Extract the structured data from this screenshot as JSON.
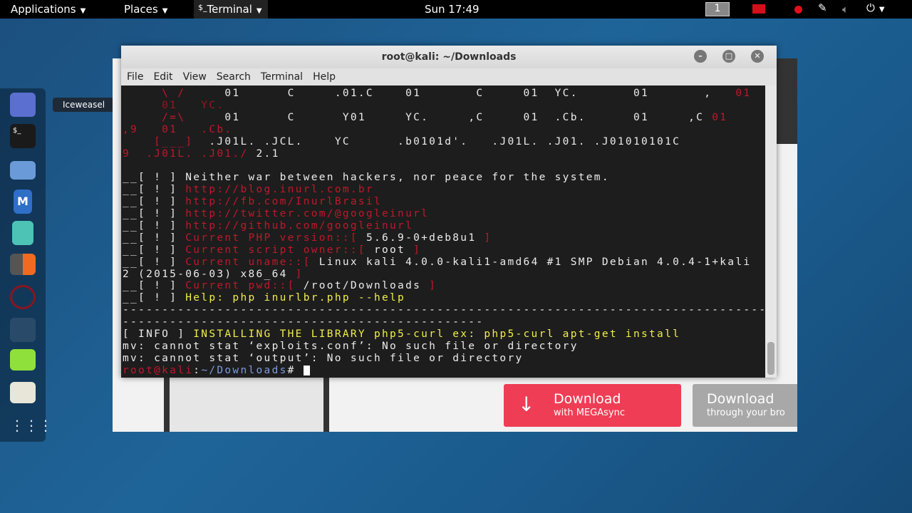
{
  "topbar": {
    "applications": "Applications",
    "places": "Places",
    "terminal_icon": "$_",
    "terminal": "Terminal",
    "clock": "Sun 17:49",
    "workspace": "1"
  },
  "dock": {
    "tooltip": "Iceweasel",
    "items": [
      "iceweasel",
      "terminal",
      "files",
      "metasploit",
      "armitage",
      "burpsuite",
      "faraday",
      "cherrytree",
      "leafpad",
      "settings",
      "show-apps"
    ]
  },
  "browser": {
    "download1_title": "Download",
    "download1_sub": "with MEGAsync",
    "download2_title": "Download",
    "download2_sub": "through your bro"
  },
  "window": {
    "title": "root@kali: ~/Downloads",
    "menu": [
      "File",
      "Edit",
      "View",
      "Search",
      "Terminal",
      "Help"
    ]
  },
  "terminal": {
    "lines": [
      [
        [
          "r",
          "     \\ /"
        ],
        [
          "w",
          "     01      C     .01.C    01       C     01  YC.       01       ,   "
        ],
        [
          "r",
          "01"
        ]
      ],
      [
        [
          "d",
          "     01   YC."
        ]
      ],
      [
        [
          "r",
          "     /=\\"
        ],
        [
          "w",
          "     01      C      Y01     YC.     ,C     01  .Cb.      01     ,C "
        ],
        [
          "r",
          "01"
        ]
      ],
      [
        [
          "r",
          ",9   01   .Cb."
        ]
      ],
      [
        [
          "r",
          "    [___]"
        ],
        [
          "w",
          "  .J01L. .JCL.    YC      .b0101d'.   .J01L. .J01. .J01010101C"
        ]
      ],
      [
        [
          "r",
          "9  .J01L. .J01./"
        ],
        [
          "w",
          " 2.1"
        ]
      ],
      [
        [
          "w",
          ""
        ]
      ],
      [
        [
          "w",
          "__[ ! ] Neither war between hackers, nor peace for the system."
        ]
      ],
      [
        [
          "w",
          "__[ ! ] "
        ],
        [
          "r",
          "http://blog.inurl.com.br"
        ]
      ],
      [
        [
          "w",
          "__[ ! ] "
        ],
        [
          "r",
          "http://fb.com/InurlBrasil"
        ]
      ],
      [
        [
          "w",
          "__[ ! ] "
        ],
        [
          "r",
          "http://twitter.com/@googleinurl"
        ]
      ],
      [
        [
          "w",
          "__[ ! ] "
        ],
        [
          "r",
          "http://github.com/googleinurl"
        ]
      ],
      [
        [
          "w",
          "__[ ! ] "
        ],
        [
          "r",
          "Current PHP version::[ "
        ],
        [
          "w",
          "5.6.9-0+deb8u1"
        ],
        [
          "r",
          " ]"
        ]
      ],
      [
        [
          "w",
          "__[ ! ] "
        ],
        [
          "r",
          "Current script owner::[ "
        ],
        [
          "w",
          "root"
        ],
        [
          "r",
          " ]"
        ]
      ],
      [
        [
          "w",
          "__[ ! ] "
        ],
        [
          "r",
          "Current uname::[ "
        ],
        [
          "w",
          "Linux kali 4.0.0-kali1-amd64 #1 SMP Debian 4.0.4-1+kali"
        ]
      ],
      [
        [
          "w",
          "2 (2015-06-03) x86_64"
        ],
        [
          "r",
          " ]"
        ]
      ],
      [
        [
          "w",
          "__[ ! ] "
        ],
        [
          "r",
          "Current pwd::[ "
        ],
        [
          "w",
          "/root/Downloads"
        ],
        [
          "r",
          " ]"
        ]
      ],
      [
        [
          "w",
          "__[ ! ] "
        ],
        [
          "y",
          "Help: php inurlbr.php --help"
        ]
      ],
      [
        [
          "w",
          "------------------------------------------------------------------------------------------"
        ]
      ],
      [
        [
          "w",
          "----------------------------------------------"
        ]
      ],
      [
        [
          "w",
          "[ INFO ] "
        ],
        [
          "y",
          "INSTALLING THE LIBRARY php5-curl ex: php5-curl apt-get install"
        ]
      ],
      [
        [
          "w",
          "mv: cannot stat ‘exploits.conf’: No such file or directory"
        ]
      ],
      [
        [
          "w",
          "mv: cannot stat ‘output’: No such file or directory"
        ]
      ],
      [
        [
          "r",
          "root@kali"
        ],
        [
          "w",
          ":"
        ],
        [
          "b",
          "~/Downloads"
        ],
        [
          "w",
          "# "
        ]
      ]
    ]
  }
}
